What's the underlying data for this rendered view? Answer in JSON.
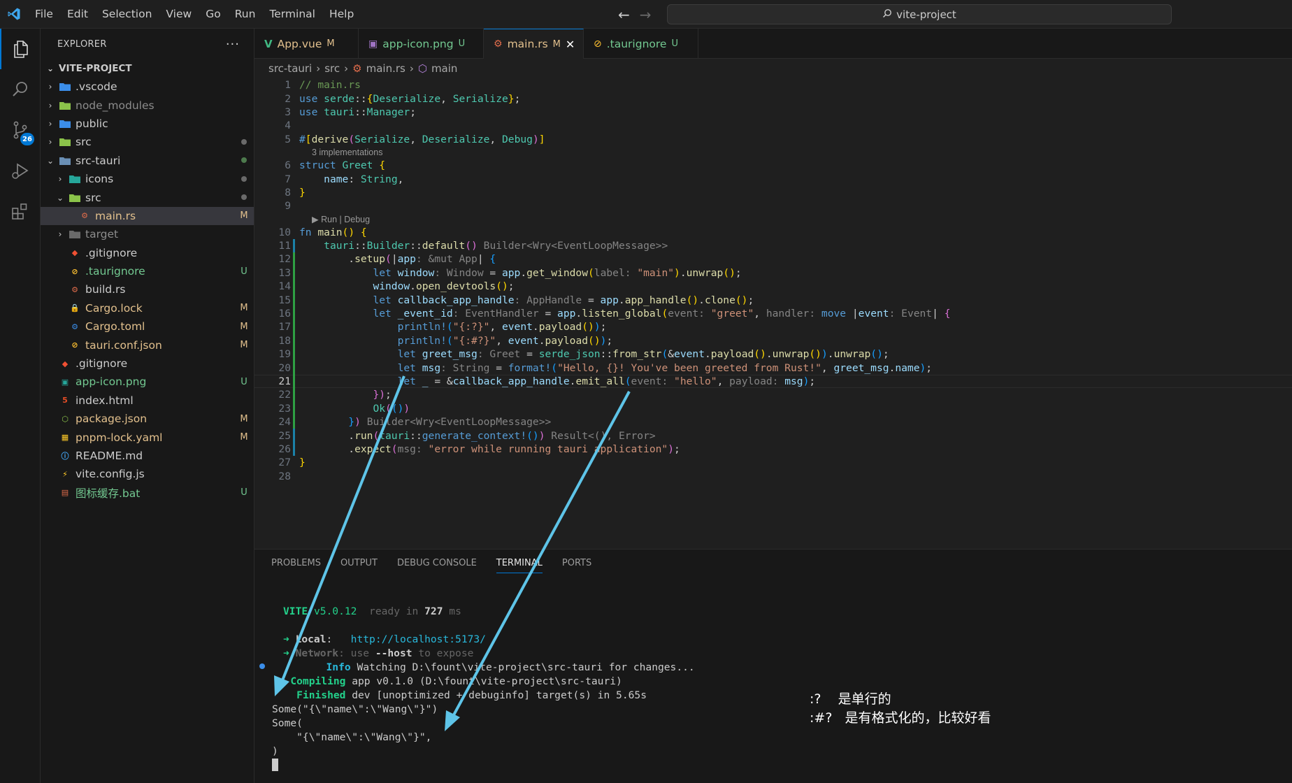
{
  "menu": [
    "File",
    "Edit",
    "Selection",
    "View",
    "Go",
    "Run",
    "Terminal",
    "Help"
  ],
  "search": {
    "text": "vite-project"
  },
  "activity": {
    "scm_badge": "26"
  },
  "explorer": {
    "title": "EXPLORER",
    "more": "···",
    "root": "VITE-PROJECT",
    "items": [
      {
        "label": ".vscode",
        "status": "",
        "color": "#cccccc"
      },
      {
        "label": "node_modules",
        "status": "",
        "color": "#8c8c8c"
      },
      {
        "label": "public",
        "status": "",
        "color": "#cccccc"
      },
      {
        "label": "src",
        "status": "dot",
        "color": "#cccccc"
      },
      {
        "label": "src-tauri",
        "status": "dot-green",
        "color": "#cccccc"
      },
      {
        "label": "icons",
        "status": "dot",
        "color": "#cccccc"
      },
      {
        "label": "src",
        "status": "dot",
        "color": "#cccccc"
      },
      {
        "label": "main.rs",
        "status": "M",
        "color": "#e2c08d"
      },
      {
        "label": "target",
        "status": "",
        "color": "#8c8c8c"
      },
      {
        "label": ".gitignore",
        "status": "",
        "color": "#cccccc"
      },
      {
        "label": ".taurignore",
        "status": "U",
        "color": "#73c991"
      },
      {
        "label": "build.rs",
        "status": "",
        "color": "#cccccc"
      },
      {
        "label": "Cargo.lock",
        "status": "M",
        "color": "#e2c08d"
      },
      {
        "label": "Cargo.toml",
        "status": "M",
        "color": "#e2c08d"
      },
      {
        "label": "tauri.conf.json",
        "status": "M",
        "color": "#e2c08d"
      },
      {
        "label": ".gitignore",
        "status": "",
        "color": "#cccccc"
      },
      {
        "label": "app-icon.png",
        "status": "U",
        "color": "#73c991"
      },
      {
        "label": "index.html",
        "status": "",
        "color": "#cccccc"
      },
      {
        "label": "package.json",
        "status": "M",
        "color": "#e2c08d"
      },
      {
        "label": "pnpm-lock.yaml",
        "status": "M",
        "color": "#e2c08d"
      },
      {
        "label": "README.md",
        "status": "",
        "color": "#cccccc"
      },
      {
        "label": "vite.config.js",
        "status": "",
        "color": "#cccccc"
      },
      {
        "label": "图标缓存.bat",
        "status": "U",
        "color": "#73c991"
      }
    ]
  },
  "tabs": [
    {
      "label": "App.vue",
      "mod": "M"
    },
    {
      "label": "app-icon.png",
      "mod": "U"
    },
    {
      "label": "main.rs",
      "mod": "M"
    },
    {
      "label": ".taurignore",
      "mod": "U"
    }
  ],
  "breadcrumb": [
    "src-tauri",
    "src",
    "main.rs",
    "main"
  ],
  "lens": {
    "impl": "3 implementations",
    "run": "▶ Run | Debug"
  },
  "panel_tabs": [
    "PROBLEMS",
    "OUTPUT",
    "DEBUG CONSOLE",
    "TERMINAL",
    "PORTS"
  ],
  "terminal": {
    "vite": "VITE",
    "version": "v5.0.12",
    "ready": "ready in",
    "ms": "727",
    "ms_unit": "ms",
    "local_label": "Local",
    "local_url": "http://localhost:5173/",
    "network_label": "Network",
    "network_text": ": use ",
    "network_host": "--host",
    "network_rest": " to expose",
    "info_label": "Info",
    "info_text": " Watching D:\\fount\\vite-project\\src-tauri for changes...",
    "compiling_label": "Compiling",
    "compiling_text": " app v0.1.0 (D:\\fount\\vite-project\\src-tauri)",
    "finished_label": "Finished",
    "finished_text": " dev [unoptimized + debuginfo] target(s) in 5.65s",
    "out1": "Some(\"{\\\"name\\\":\\\"Wang\\\"}\")",
    "out2": "Some(",
    "out3": "    \"{\\\"name\\\":\\\"Wang\\\"}\",",
    "out4": ")"
  },
  "notes": {
    "line1": ":?    是单行的",
    "line2": ":#?   是有格式化的，比较好看"
  },
  "colors": {
    "accent": "#0078d4",
    "arrow": "#5ec4e8"
  }
}
